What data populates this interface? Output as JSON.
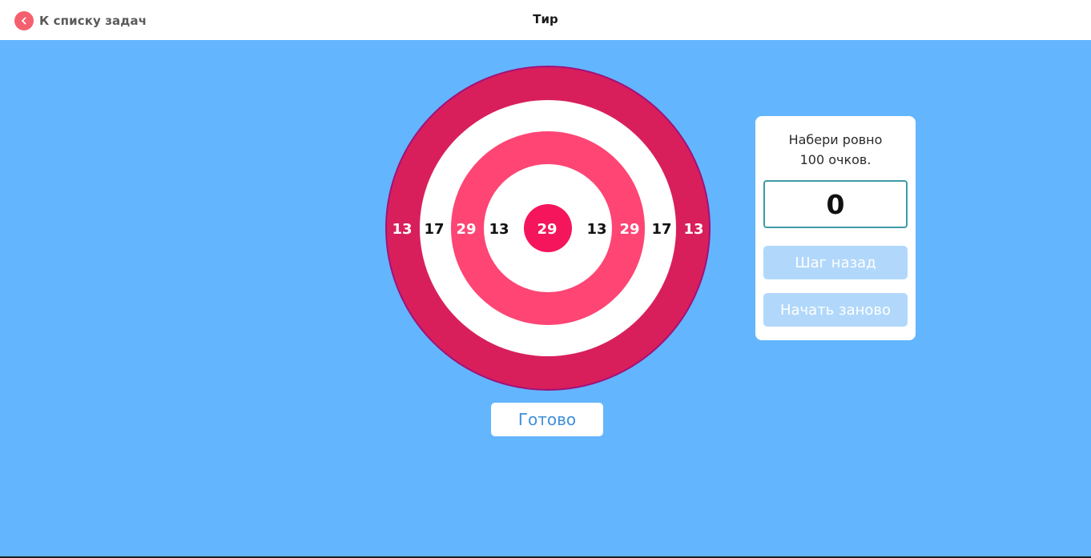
{
  "header": {
    "back_label": "К списку задач",
    "back_icon": "chevron-left-icon",
    "title": "Тир"
  },
  "target": {
    "rings": [
      {
        "name": "outer",
        "points": "13",
        "fill": "#d81f5c",
        "label_color": "#ffffff"
      },
      {
        "name": "second",
        "points": "17",
        "fill": "#ffffff",
        "label_color": "#111111"
      },
      {
        "name": "third",
        "points": "29",
        "fill": "#fe4574",
        "label_color": "#ffffff"
      },
      {
        "name": "fourth",
        "points": "13",
        "fill": "#ffffff",
        "label_color": "#111111"
      },
      {
        "name": "bullseye",
        "points": "29",
        "fill": "#f5155c",
        "label_color": "#ffffff"
      }
    ]
  },
  "panel": {
    "task_line1": "Набери ровно",
    "task_line2": "100 очков.",
    "score": "0",
    "step_back_label": "Шаг назад",
    "restart_label": "Начать заново"
  },
  "done_label": "Готово",
  "colors": {
    "background": "#63b5fd",
    "accent": "#f4606f",
    "disabled_button": "#b1d8fb",
    "done_text": "#3f8fd9",
    "score_border": "#3f9aa8"
  }
}
